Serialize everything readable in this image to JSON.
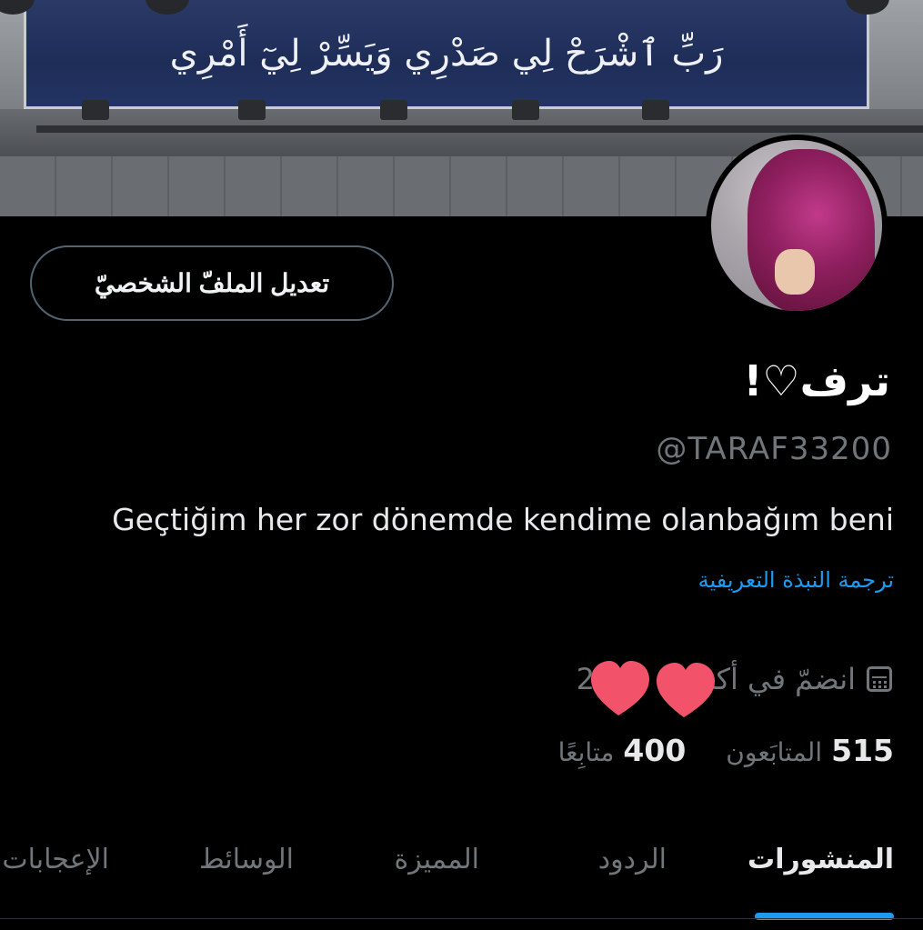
{
  "banner": {
    "sign_text": "رَبِّ ٱشْرَحْ لِي صَدْرِي وَيَسِّرْ لِيٓ أَمْرِي"
  },
  "profile": {
    "display_name": "ترف♡!",
    "handle": "@TARAF33200",
    "bio": "Geçtiğim her zor dönemde kendime olanbağım beni",
    "translate_bio": "ترجمة النبذة التعريفية",
    "joined_text": "انضمّ في أكت",
    "joined_year_partial": "20",
    "edit_button": "تعديل الملفّ الشخصيّ"
  },
  "stats": {
    "followers_count": "515",
    "followers_label": "المتابَعون",
    "following_count": "400",
    "following_label": "متابِعًا"
  },
  "tabs": [
    {
      "label": "المنشورات",
      "active": true
    },
    {
      "label": "الردود",
      "active": false
    },
    {
      "label": "المميزة",
      "active": false
    },
    {
      "label": "الوسائط",
      "active": false
    },
    {
      "label": "الإعجابات",
      "active": false
    }
  ],
  "colors": {
    "accent": "#1d9bf0",
    "muted": "#71767b",
    "heart": "#f2536a"
  },
  "icons": {
    "calendar": "calendar-icon",
    "heart_sticker": "heart-sticker-icon"
  }
}
